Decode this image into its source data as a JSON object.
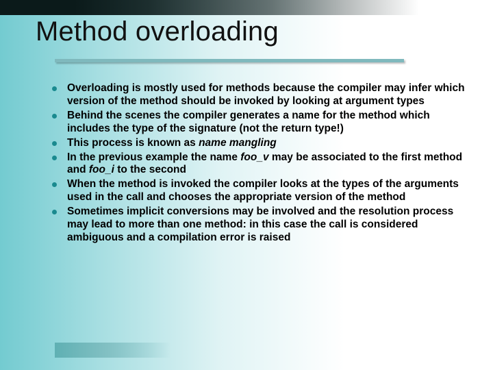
{
  "title": "Method overloading",
  "bullets": [
    {
      "html": "Overloading is mostly used for methods because the compiler may infer which version of the method should be invoked by looking at argument types"
    },
    {
      "html": "Behind the scenes the compiler generates a name for the method which includes the type of the signature (not the return type!)"
    },
    {
      "html": "This process is known as <span class=\"em\">name mangling</span>"
    },
    {
      "html": "In the previous example the name <span class=\"em\">foo_v</span> may be associated to the first method and <span class=\"em\">foo_i</span> to the second"
    },
    {
      "html": "When the method is invoked the compiler looks at the types of the arguments used in the call and chooses the appropriate version of the method"
    },
    {
      "html": "Sometimes implicit conversions may be involved and the resolution process may lead to more than one method: in this case the call is considered ambiguous and a compilation error is raised"
    }
  ],
  "colors": {
    "accent": "#1a8a8f",
    "underline": "#7fb9bd"
  }
}
